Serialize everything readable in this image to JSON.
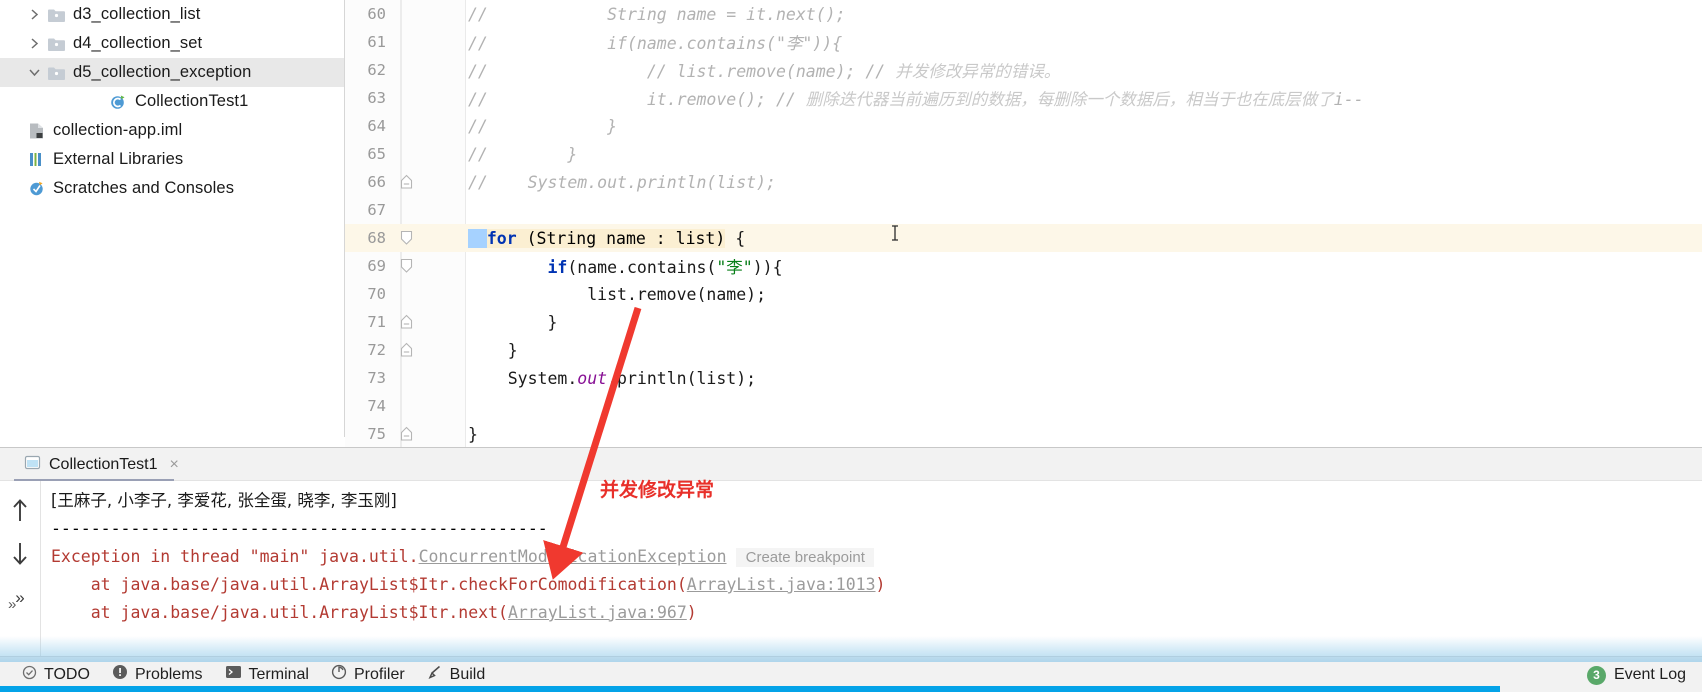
{
  "project_tree": {
    "items": [
      {
        "label": "d3_collection_list",
        "icon": "folder-icon",
        "chevron": "chevron-right-icon",
        "indent": 1,
        "selected": false
      },
      {
        "label": "d4_collection_set",
        "icon": "folder-icon",
        "chevron": "chevron-right-icon",
        "indent": 1,
        "selected": false
      },
      {
        "label": "d5_collection_exception",
        "icon": "folder-icon",
        "chevron": "chevron-down-icon",
        "indent": 1,
        "selected": true
      },
      {
        "label": "CollectionTest1",
        "icon": "java-class-icon",
        "chevron": "none",
        "indent": 3,
        "selected": false
      },
      {
        "label": "collection-app.iml",
        "icon": "iml-file-icon",
        "chevron": "none",
        "indent": 0,
        "selected": false
      },
      {
        "label": "External Libraries",
        "icon": "libraries-icon",
        "chevron": "none",
        "indent": 0,
        "selected": false
      },
      {
        "label": "Scratches and Consoles",
        "icon": "scratches-icon",
        "chevron": "none",
        "indent": 0,
        "selected": false
      }
    ]
  },
  "editor": {
    "lines": [
      {
        "num": "60",
        "fold": "none",
        "current": false,
        "indent": 0,
        "segments": [
          {
            "cls": "cm",
            "text": "//"
          },
          {
            "cls": "pl",
            "text": "            "
          },
          {
            "cls": "cm",
            "text": "String name = it.next();"
          }
        ]
      },
      {
        "num": "61",
        "fold": "none",
        "current": false,
        "indent": 0,
        "segments": [
          {
            "cls": "cm",
            "text": "//"
          },
          {
            "cls": "pl",
            "text": "            "
          },
          {
            "cls": "cm",
            "text": "if(name.contains(\"李\")){"
          }
        ]
      },
      {
        "num": "62",
        "fold": "none",
        "current": false,
        "indent": 0,
        "segments": [
          {
            "cls": "cm",
            "text": "//"
          },
          {
            "cls": "pl",
            "text": "                "
          },
          {
            "cls": "cm",
            "text": "// list.remove(name); // "
          },
          {
            "cls": "cm-cn",
            "text": "并发修改异常的错误。"
          }
        ]
      },
      {
        "num": "63",
        "fold": "none",
        "current": false,
        "indent": 0,
        "segments": [
          {
            "cls": "cm",
            "text": "//"
          },
          {
            "cls": "pl",
            "text": "                "
          },
          {
            "cls": "cm",
            "text": "it.remove(); // "
          },
          {
            "cls": "cm-cn",
            "text": "删除迭代器当前遍历到的数据，每删除一个数据后，相当于也在底层做了"
          },
          {
            "cls": "cm",
            "text": "i--"
          }
        ]
      },
      {
        "num": "64",
        "fold": "none",
        "current": false,
        "indent": 0,
        "segments": [
          {
            "cls": "cm",
            "text": "//"
          },
          {
            "cls": "pl",
            "text": "            "
          },
          {
            "cls": "cm",
            "text": "}"
          }
        ]
      },
      {
        "num": "65",
        "fold": "none",
        "current": false,
        "indent": 0,
        "segments": [
          {
            "cls": "cm",
            "text": "//"
          },
          {
            "cls": "pl",
            "text": "        "
          },
          {
            "cls": "cm",
            "text": "}"
          }
        ]
      },
      {
        "num": "66",
        "fold": "collapse",
        "current": false,
        "indent": 0,
        "segments": [
          {
            "cls": "cm",
            "text": "//"
          },
          {
            "cls": "pl",
            "text": "    "
          },
          {
            "cls": "cm",
            "text": "System.out.println(list);"
          }
        ]
      },
      {
        "num": "67",
        "fold": "none",
        "current": false,
        "indent": 0,
        "segments": []
      },
      {
        "num": "68",
        "fold": "expand",
        "current": true,
        "indent": 0,
        "segments": [
          {
            "cls": "sel-block",
            "text": "  "
          },
          {
            "cls": "caret",
            "text": ""
          },
          {
            "cls": "kw hl-for",
            "text": "for"
          },
          {
            "cls": "hl-for",
            "text": " (String name : list)"
          },
          {
            "cls": "pl",
            "text": " {"
          }
        ]
      },
      {
        "num": "69",
        "fold": "expand",
        "current": false,
        "indent": 0,
        "segments": [
          {
            "cls": "pl",
            "text": "        "
          },
          {
            "cls": "kw",
            "text": "if"
          },
          {
            "cls": "pl",
            "text": "(name.contains("
          },
          {
            "cls": "str",
            "text": "\"李\""
          },
          {
            "cls": "pl",
            "text": ")){"
          }
        ]
      },
      {
        "num": "70",
        "fold": "none",
        "current": false,
        "indent": 0,
        "segments": [
          {
            "cls": "pl",
            "text": "            list.remove(name);"
          }
        ]
      },
      {
        "num": "71",
        "fold": "collapse",
        "current": false,
        "indent": 0,
        "segments": [
          {
            "cls": "pl",
            "text": "        }"
          }
        ]
      },
      {
        "num": "72",
        "fold": "collapse",
        "current": false,
        "indent": 0,
        "segments": [
          {
            "cls": "pl",
            "text": "    }"
          }
        ]
      },
      {
        "num": "73",
        "fold": "none",
        "current": false,
        "indent": 0,
        "segments": [
          {
            "cls": "pl",
            "text": "    System."
          },
          {
            "cls": "fld",
            "text": "out"
          },
          {
            "cls": "pl",
            "text": ".println(list);"
          }
        ]
      },
      {
        "num": "74",
        "fold": "none",
        "current": false,
        "indent": 0,
        "segments": []
      },
      {
        "num": "75",
        "fold": "collapse",
        "current": false,
        "indent": 0,
        "segments": [
          {
            "cls": "pl",
            "text": "}"
          }
        ]
      }
    ]
  },
  "run_panel": {
    "tab_label": "CollectionTest1",
    "tab_close": "×",
    "tab_icon": "console-icon",
    "side_buttons": [
      {
        "name": "scroll-up-button",
        "glyph": "↑"
      },
      {
        "name": "scroll-down-button",
        "glyph": "↓"
      },
      {
        "name": "expand-more-button",
        "glyph": "»"
      }
    ],
    "console_lines": [
      {
        "type": "cn",
        "text": "[王麻子, 小李子, 李爱花, 张全蛋, 晓李, 李玉刚]"
      },
      {
        "type": "plain",
        "text": "--------------------------------------------------"
      },
      {
        "type": "exception",
        "prefix": "Exception in thread \"main\" java.util.",
        "link": "ConcurrentModificationException",
        "breakpoint": "Create breakpoint"
      },
      {
        "type": "trace",
        "prefix": "    at java.base/java.util.ArrayList$Itr.checkForComodification(",
        "link": "ArrayList.java:1013",
        "suffix": ")"
      },
      {
        "type": "trace",
        "prefix": "    at java.base/java.util.ArrayList$Itr.next(",
        "link": "ArrayList.java:967",
        "suffix": ")"
      }
    ]
  },
  "status_bar": {
    "items": [
      {
        "label": "TODO",
        "icon": "todo-icon"
      },
      {
        "label": "Problems",
        "icon": "problems-icon"
      },
      {
        "label": "Terminal",
        "icon": "terminal-icon"
      },
      {
        "label": "Profiler",
        "icon": "profiler-icon"
      },
      {
        "label": "Build",
        "icon": "build-icon"
      }
    ],
    "event_log_label": "Event Log",
    "event_log_count": "3"
  },
  "annotation": {
    "text": "并发修改异常",
    "color": "#e8302a"
  }
}
